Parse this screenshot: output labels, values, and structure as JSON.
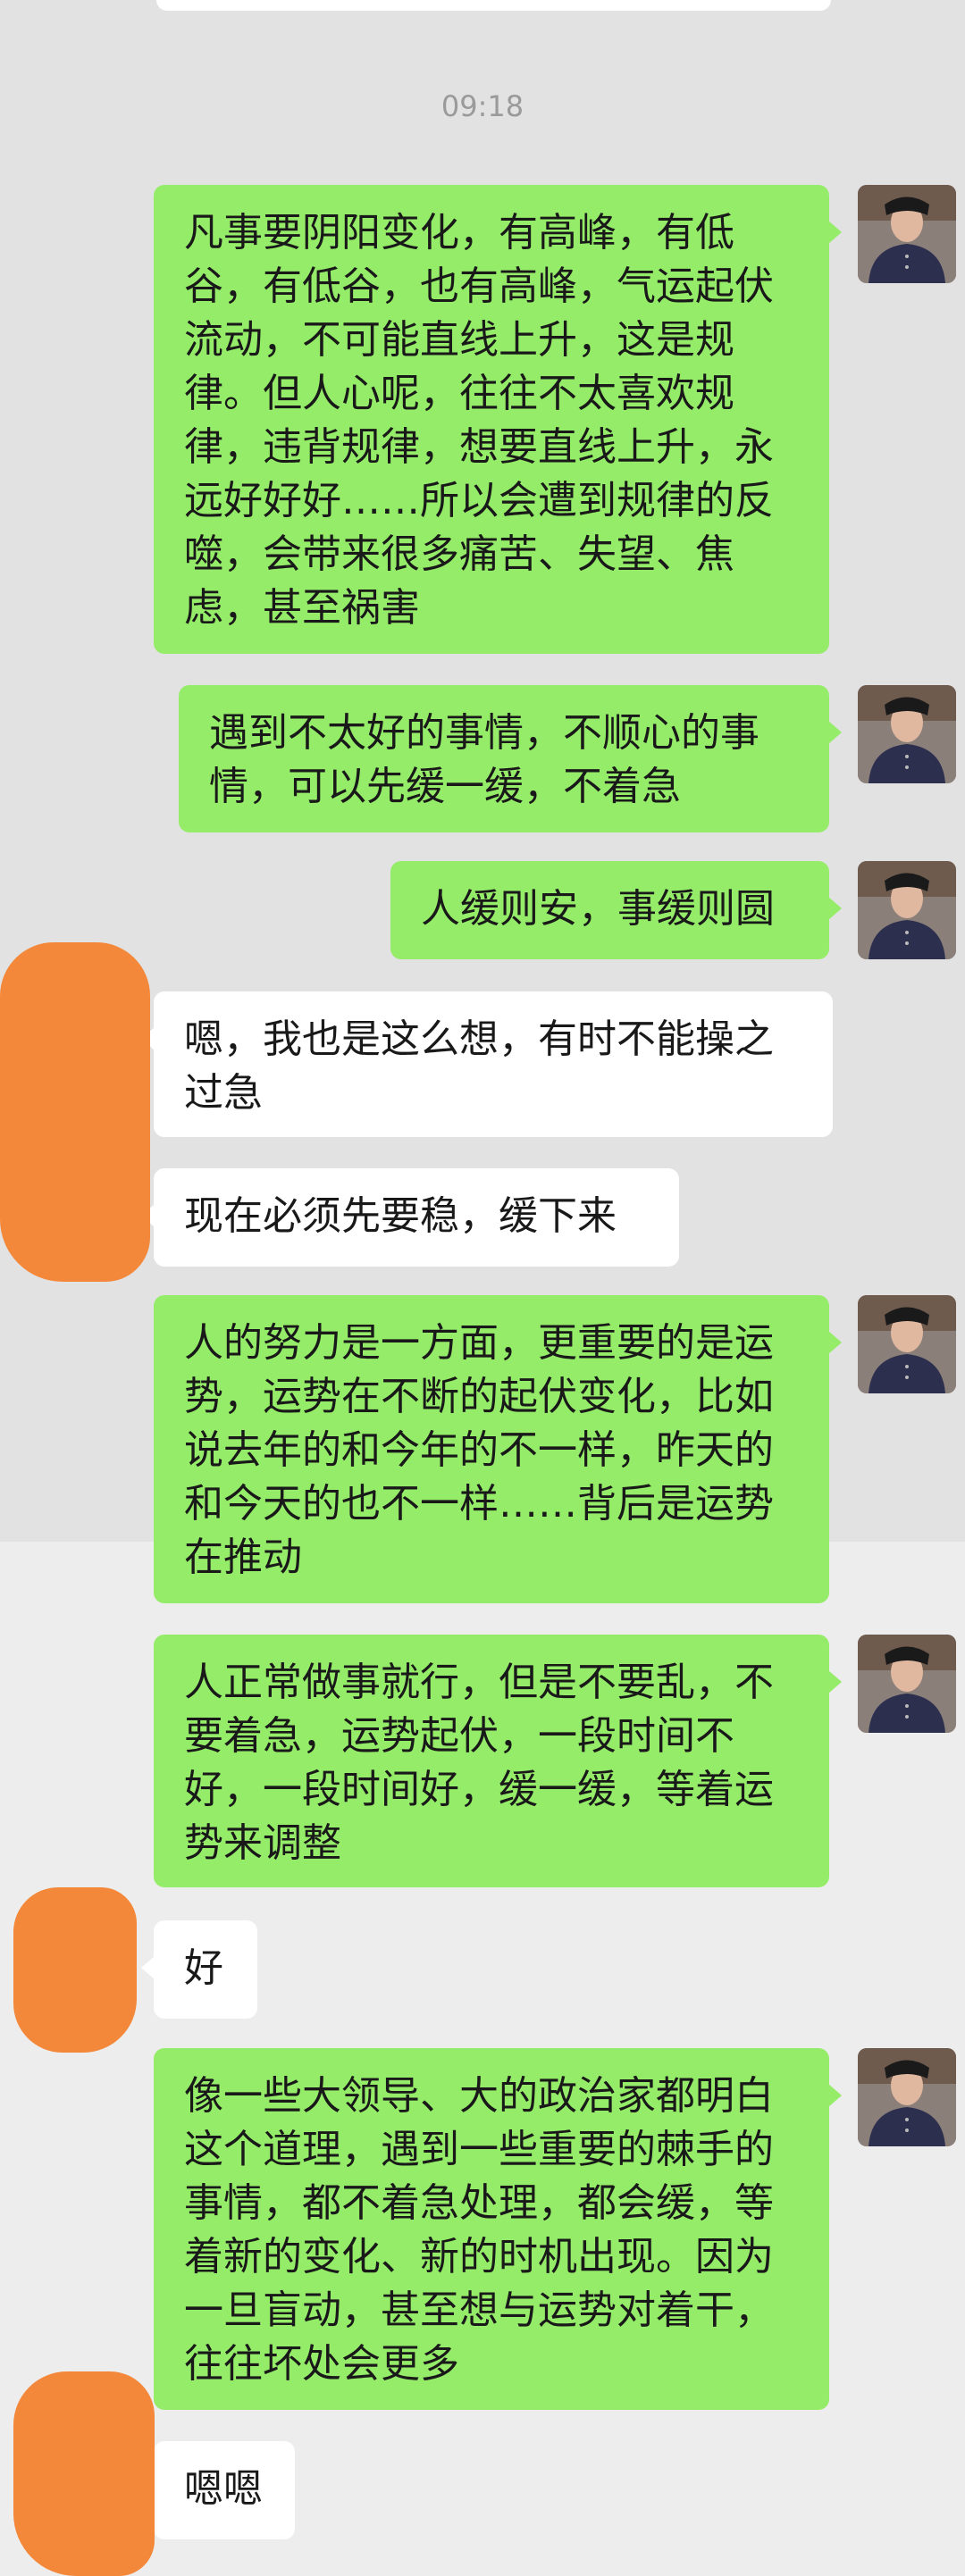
{
  "chat": {
    "timestamp": "09:18",
    "messages": [
      {
        "side": "right",
        "text": "凡事要阴阳变化，有高峰，有低谷，有低谷，也有高峰，气运起伏流动，不可能直线上升，这是规律。但人心呢，往往不太喜欢规律，违背规律，想要直线上升，永远好好好……所以会遭到规律的反噬，会带来很多痛苦、失望、焦虑，甚至祸害"
      },
      {
        "side": "right",
        "text": "遇到不太好的事情，不顺心的事情，可以先缓一缓，不着急"
      },
      {
        "side": "right",
        "text": "人缓则安，事缓则圆"
      },
      {
        "side": "left",
        "text": "嗯，我也是这么想，有时不能操之过急"
      },
      {
        "side": "left",
        "text": "现在必须先要稳，缓下来"
      },
      {
        "side": "right",
        "text": "人的努力是一方面，更重要的是运势，运势在不断的起伏变化，比如说去年的和今年的不一样，昨天的和今天的也不一样……背后是运势在推动"
      },
      {
        "side": "right",
        "text": "人正常做事就行，但是不要乱，不要着急，运势起伏，一段时间不好，一段时间好，缓一缓，等着运势来调整"
      },
      {
        "side": "left",
        "text": "好"
      },
      {
        "side": "right",
        "text": "像一些大领导、大的政治家都明白这个道理，遇到一些重要的棘手的事情，都不着急处理，都会缓，等着新的变化、新的时机出现。因为一旦盲动，甚至想与运势对着干，往往坏处会更多"
      },
      {
        "side": "left",
        "text": "嗯嗯"
      }
    ]
  },
  "icons": {
    "avatar": "contact-avatar-photo-icon",
    "redaction": "redaction-marker"
  },
  "colors": {
    "sent_bubble": "#95ec69",
    "received_bubble": "#ffffff",
    "background": "#ededed",
    "redaction": "#f4883a"
  }
}
